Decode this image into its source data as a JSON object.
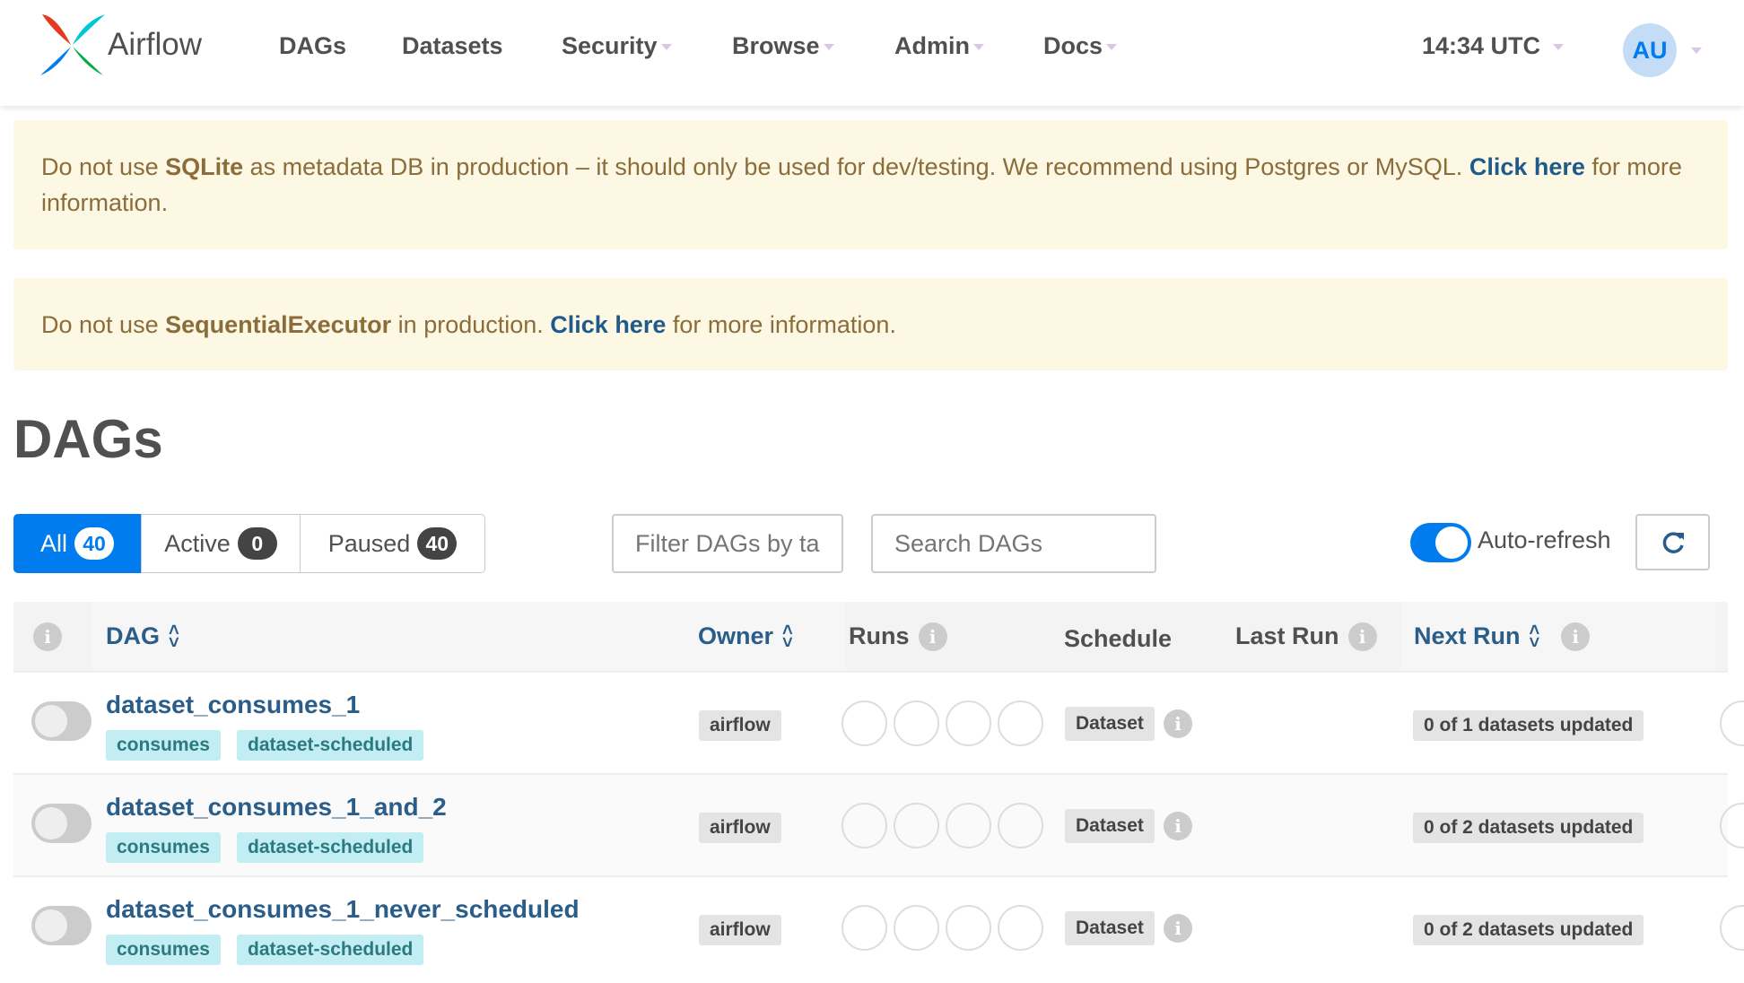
{
  "nav": {
    "brand": "Airflow",
    "items": [
      {
        "label": "DAGs",
        "dropdown": false
      },
      {
        "label": "Datasets",
        "dropdown": false
      },
      {
        "label": "Security",
        "dropdown": true
      },
      {
        "label": "Browse",
        "dropdown": true
      },
      {
        "label": "Admin",
        "dropdown": true
      },
      {
        "label": "Docs",
        "dropdown": true
      }
    ],
    "time": "14:34 UTC",
    "avatar": "AU"
  },
  "alerts": [
    {
      "pre": "Do not use ",
      "strong": "SQLite",
      "mid": " as metadata DB in production – it should only be used for dev/testing. We recommend using Postgres or MySQL. ",
      "link": "Click here",
      "post": " for more information."
    },
    {
      "pre": "Do not use ",
      "strong": "SequentialExecutor",
      "mid": " in production. ",
      "link": "Click here",
      "post": " for more information."
    }
  ],
  "page_title": "DAGs",
  "filters": {
    "all": {
      "label": "All",
      "count": "40"
    },
    "active": {
      "label": "Active",
      "count": "0"
    },
    "paused": {
      "label": "Paused",
      "count": "40"
    },
    "tag_placeholder": "Filter DAGs by tag",
    "search_placeholder": "Search DAGs",
    "auto_refresh": "Auto-refresh",
    "auto_refresh_on": true
  },
  "table": {
    "headers": {
      "dag": "DAG",
      "owner": "Owner",
      "runs": "Runs",
      "schedule": "Schedule",
      "last_run": "Last Run",
      "next_run": "Next Run"
    },
    "rows": [
      {
        "name": "dataset_consumes_1",
        "tags": [
          "consumes",
          "dataset-scheduled"
        ],
        "owner": "airflow",
        "schedule": "Dataset",
        "next_run": "0 of 1 datasets updated",
        "paused": true
      },
      {
        "name": "dataset_consumes_1_and_2",
        "tags": [
          "consumes",
          "dataset-scheduled"
        ],
        "owner": "airflow",
        "schedule": "Dataset",
        "next_run": "0 of 2 datasets updated",
        "paused": true
      },
      {
        "name": "dataset_consumes_1_never_scheduled",
        "tags": [
          "consumes",
          "dataset-scheduled"
        ],
        "owner": "airflow",
        "schedule": "Dataset",
        "next_run": "0 of 2 datasets updated",
        "paused": true
      }
    ]
  },
  "colors": {
    "brand": "#017cee",
    "link": "#2a5d8a",
    "alert_bg": "#fcf8e3",
    "tag_bg": "#c2edf2"
  }
}
